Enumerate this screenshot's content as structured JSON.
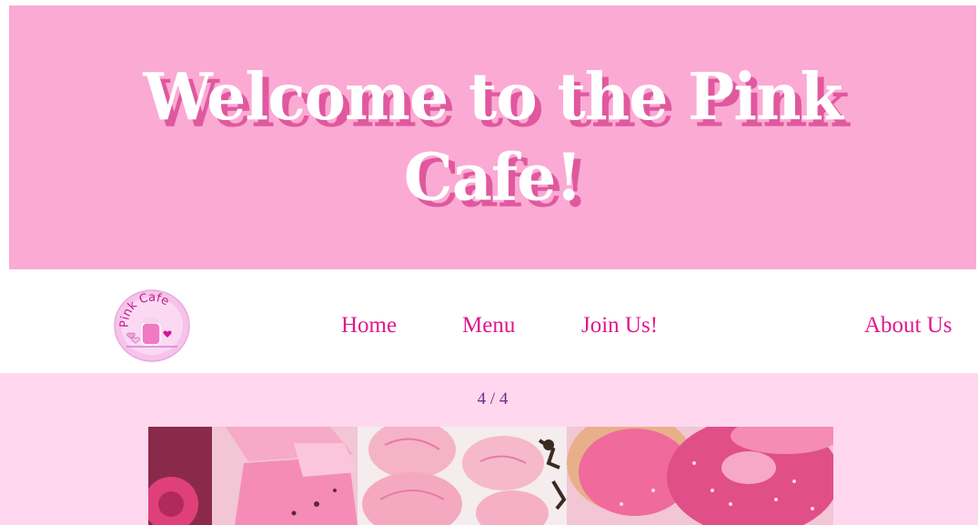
{
  "hero": {
    "title": "Welcome to the Pink Cafe!"
  },
  "nav": {
    "logo_text": "Pink Cafe",
    "items": [
      {
        "label": "Home"
      },
      {
        "label": "Menu"
      },
      {
        "label": "Join Us!"
      },
      {
        "label": "About Us"
      }
    ]
  },
  "slideshow": {
    "counter": "4 / 4",
    "image_description_icon": "pink-desserts-photo"
  },
  "colors": {
    "hero_bg": "#fbaad3",
    "title_shadow": "#e0589e",
    "nav_link": "#e0188c",
    "slideshow_bg": "#ffd8ef",
    "counter_text": "#7a2a8a"
  }
}
